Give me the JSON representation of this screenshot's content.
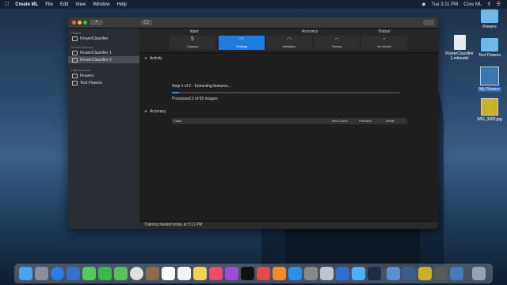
{
  "menubar": {
    "app_name": "Create ML",
    "menus": [
      "File",
      "Edit",
      "View",
      "Window",
      "Help"
    ],
    "clock": "Tue 3:11 PM",
    "user": "Core ML"
  },
  "window": {
    "sidebar": {
      "project_header": "Project",
      "project_item": "FlowerClassifier",
      "model_sources_header": "Model Sources",
      "model_sources": [
        "FlowerClassifier 1",
        "FlowerClassifier 2"
      ],
      "data_sources_header": "Data Sources",
      "data_sources": [
        "Flowers",
        "Test Flowers"
      ]
    },
    "tabs": {
      "input_header": "Input",
      "accuracy_header": "Accuracy",
      "output_header": "Output",
      "classes_count": "5",
      "classes_label": "Classes",
      "training_label": "Training",
      "validation_label": "Validation",
      "testing_value": "--",
      "testing_label": "Testing",
      "no_model_label": "No Model"
    },
    "activity": {
      "header": "Activity",
      "step_text": "Step 1 of 2 - Extracting features...",
      "processed_text": "Processed 2 of 65 images",
      "progress": 0.03
    },
    "accuracy": {
      "header": "Accuracy",
      "columns": [
        "Class",
        "Item Count",
        "Precision",
        "Recall"
      ]
    },
    "status_bar": "Training started today at 3:11 PM"
  },
  "desktop_icons": [
    {
      "label": "Flowers"
    },
    {
      "label": "FlowerClassifier 1.mlmodel"
    },
    {
      "label": "Test Flowers"
    },
    {
      "label": "My Flowers"
    },
    {
      "label": "IMG_3082.jpg"
    }
  ],
  "colors": {
    "accent": "#1e7de0",
    "window_bg": "#1f1f1f",
    "sidebar_bg": "#2a2d33"
  }
}
